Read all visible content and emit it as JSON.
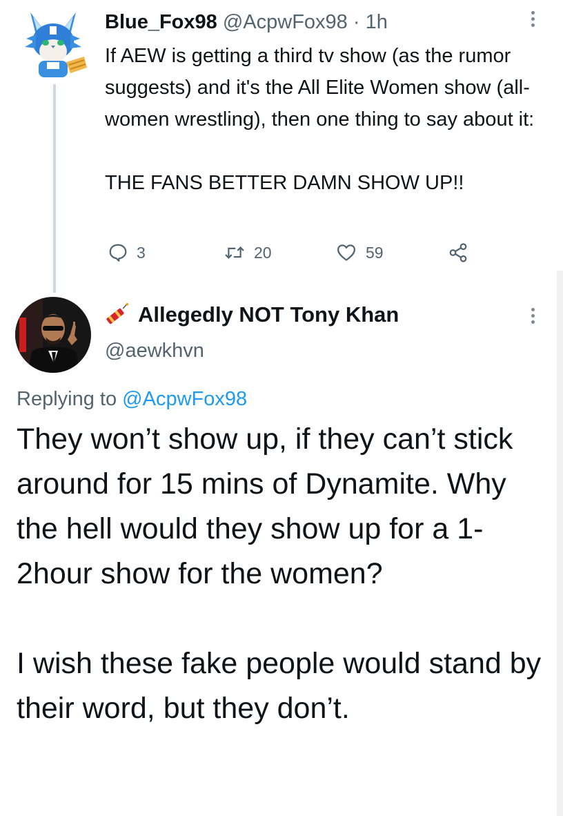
{
  "tweet1": {
    "display_name": "Blue_Fox98",
    "handle": "@AcpwFox98",
    "separator": "·",
    "time": "1h",
    "text": "If AEW is getting a third tv show (as the rumor suggests) and it's the All Elite Women show (all-women wrestling), then one thing to say about it:\n\nTHE FANS BETTER DAMN SHOW UP!!",
    "actions": {
      "replies": "3",
      "retweets": "20",
      "likes": "59"
    },
    "avatar_icon": "blue-fox-avatar",
    "more_icon": "more-vertical-icon"
  },
  "tweet2": {
    "display_name": "Allegedly NOT Tony Khan",
    "name_emoji": "firecracker-icon",
    "handle": "@aewkhvn",
    "replying_label": "Replying to",
    "replying_to": "@AcpwFox98",
    "text": "They won’t show up, if they can’t stick around for 15 mins of Dynamite. Why the hell would they show up for a 1-2hour show for the women?\n\nI wish these fake people would stand by their word, but they don’t.",
    "avatar_icon": "user-photo-avatar",
    "more_icon": "more-vertical-icon"
  },
  "colors": {
    "text": "#0f1419",
    "secondary": "#536471",
    "link": "#1d9bf0",
    "thread_line": "#cfd9de",
    "background": "#ffffff"
  }
}
